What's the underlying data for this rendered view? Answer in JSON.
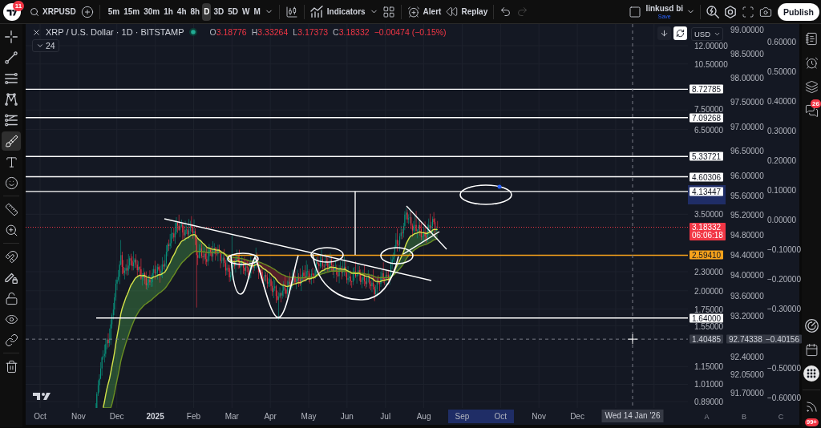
{
  "top_bar": {
    "notification_badge": "11",
    "symbol": "XRPUSD",
    "intervals": [
      {
        "label": "5m",
        "selected": false
      },
      {
        "label": "15m",
        "selected": false
      },
      {
        "label": "30m",
        "selected": false
      },
      {
        "label": "1h",
        "selected": false
      },
      {
        "label": "4h",
        "selected": false
      },
      {
        "label": "8h",
        "selected": false
      },
      {
        "label": "D",
        "selected": true
      },
      {
        "label": "3D",
        "selected": false
      },
      {
        "label": "5D",
        "selected": false
      },
      {
        "label": "W",
        "selected": false
      },
      {
        "label": "M",
        "selected": false
      }
    ],
    "indicators_label": "Indicators",
    "alert_label": "Alert",
    "replay_label": "Replay",
    "history": [
      {
        "kind": "undo",
        "disabled": false
      },
      {
        "kind": "redo",
        "disabled": true
      }
    ],
    "layout_name": "linkusd bi",
    "save_label": "Save",
    "publish_label": "Publish"
  },
  "drawing_toolbar": [
    {
      "tools": [
        {
          "kind": "crosshair",
          "selected": false
        },
        {
          "kind": "trend-line",
          "selected": false
        },
        {
          "kind": "fib",
          "selected": false
        },
        {
          "kind": "pattern",
          "selected": false
        },
        {
          "kind": "prediction",
          "selected": false
        },
        {
          "kind": "brush",
          "selected": true
        },
        {
          "kind": "text",
          "selected": false
        },
        {
          "kind": "emoji",
          "selected": false
        }
      ]
    },
    {
      "tools": [
        {
          "kind": "ruler",
          "selected": false
        },
        {
          "kind": "zoom",
          "selected": false
        }
      ]
    },
    {
      "tools": [
        {
          "kind": "magnet",
          "selected": false
        },
        {
          "kind": "lock-drawing",
          "selected": false
        },
        {
          "kind": "lock",
          "selected": false
        },
        {
          "kind": "hide",
          "selected": false
        },
        {
          "kind": "link",
          "selected": false
        }
      ]
    },
    {
      "tools": [
        {
          "kind": "trash",
          "selected": false
        }
      ]
    }
  ],
  "legend": {
    "title": "XRP / U.S. Dollar · 1D · BITSTAMP",
    "ohlc": [
      {
        "key": "O",
        "value": "3.18776"
      },
      {
        "key": "H",
        "value": "3.33264"
      },
      {
        "key": "L",
        "value": "3.17373"
      },
      {
        "key": "C",
        "value": "3.18332"
      }
    ],
    "change": "−0.00474 (−0.15%)",
    "indicators_count": "24"
  },
  "chart_controls": {
    "buttons": [
      {
        "kind": "scroll-down",
        "selected": false
      },
      {
        "kind": "sync",
        "selected": true
      }
    ],
    "currency": "USD"
  },
  "scale_a": {
    "ticks": [
      "12.00000",
      "10.50000",
      "7.50000",
      "6.50000",
      "3.50000",
      "2.30000",
      "2.00000",
      "1.75000",
      "1.55000",
      "1.15000",
      "1.01000",
      "0.89000"
    ],
    "labels": [
      {
        "kind": "drawing",
        "value": "8.72785"
      },
      {
        "kind": "drawing",
        "value": "7.09268"
      },
      {
        "kind": "drawing",
        "value": "5.33721"
      },
      {
        "kind": "drawing",
        "value": "4.60306"
      },
      {
        "kind": "drawing",
        "value": "4.13447"
      },
      {
        "kind": "price",
        "value": "3.18332",
        "countdown": "06:06:18"
      },
      {
        "kind": "level",
        "value": "2.59410"
      },
      {
        "kind": "drawing",
        "value": "1.64000"
      }
    ],
    "crosshair": "1.40485",
    "highlighted_range": true
  },
  "scale_b": {
    "ticks": [
      "99.00000",
      "98.50000",
      "98.00000",
      "97.50000",
      "97.00000",
      "96.50000",
      "96.00000",
      "95.60000",
      "95.20000",
      "94.80000",
      "94.40000",
      "94.00000",
      "93.60000",
      "93.20000",
      "92.40000",
      "92.05000",
      "91.70000"
    ],
    "crosshair": "92.74338"
  },
  "scale_c": {
    "ticks": [
      "0.60000",
      "0.50000",
      "0.40000",
      "0.30000",
      "0.20000",
      "0.10000",
      "0.00000",
      "−0.10000",
      "−0.20000",
      "−0.30000",
      "−0.50000",
      "−0.60000"
    ],
    "crosshair": "−0.40156"
  },
  "time_axis": {
    "months": [
      {
        "label": "Oct",
        "kind": "month",
        "highlighted": false
      },
      {
        "label": "Nov",
        "kind": "month",
        "highlighted": false
      },
      {
        "label": "Dec",
        "kind": "month",
        "highlighted": false
      },
      {
        "label": "2025",
        "kind": "year",
        "highlighted": false
      },
      {
        "label": "Feb",
        "kind": "month",
        "highlighted": false
      },
      {
        "label": "Mar",
        "kind": "month",
        "highlighted": false
      },
      {
        "label": "Apr",
        "kind": "month",
        "highlighted": false
      },
      {
        "label": "May",
        "kind": "month",
        "highlighted": false
      },
      {
        "label": "Jun",
        "kind": "month",
        "highlighted": false
      },
      {
        "label": "Jul",
        "kind": "month",
        "highlighted": false
      },
      {
        "label": "Aug",
        "kind": "month",
        "highlighted": false
      },
      {
        "label": "Sep",
        "kind": "month",
        "highlighted": true
      },
      {
        "label": "Oct",
        "kind": "month",
        "highlighted": true
      },
      {
        "label": "Nov",
        "kind": "month",
        "highlighted": false
      },
      {
        "label": "Dec",
        "kind": "month",
        "highlighted": false
      }
    ],
    "crosshair": "Wed 14 Jan '26",
    "scale_names": [
      "A",
      "B",
      "C"
    ]
  },
  "right_sidebar": {
    "chat_badge": "26",
    "notification_badge": "99+"
  }
}
